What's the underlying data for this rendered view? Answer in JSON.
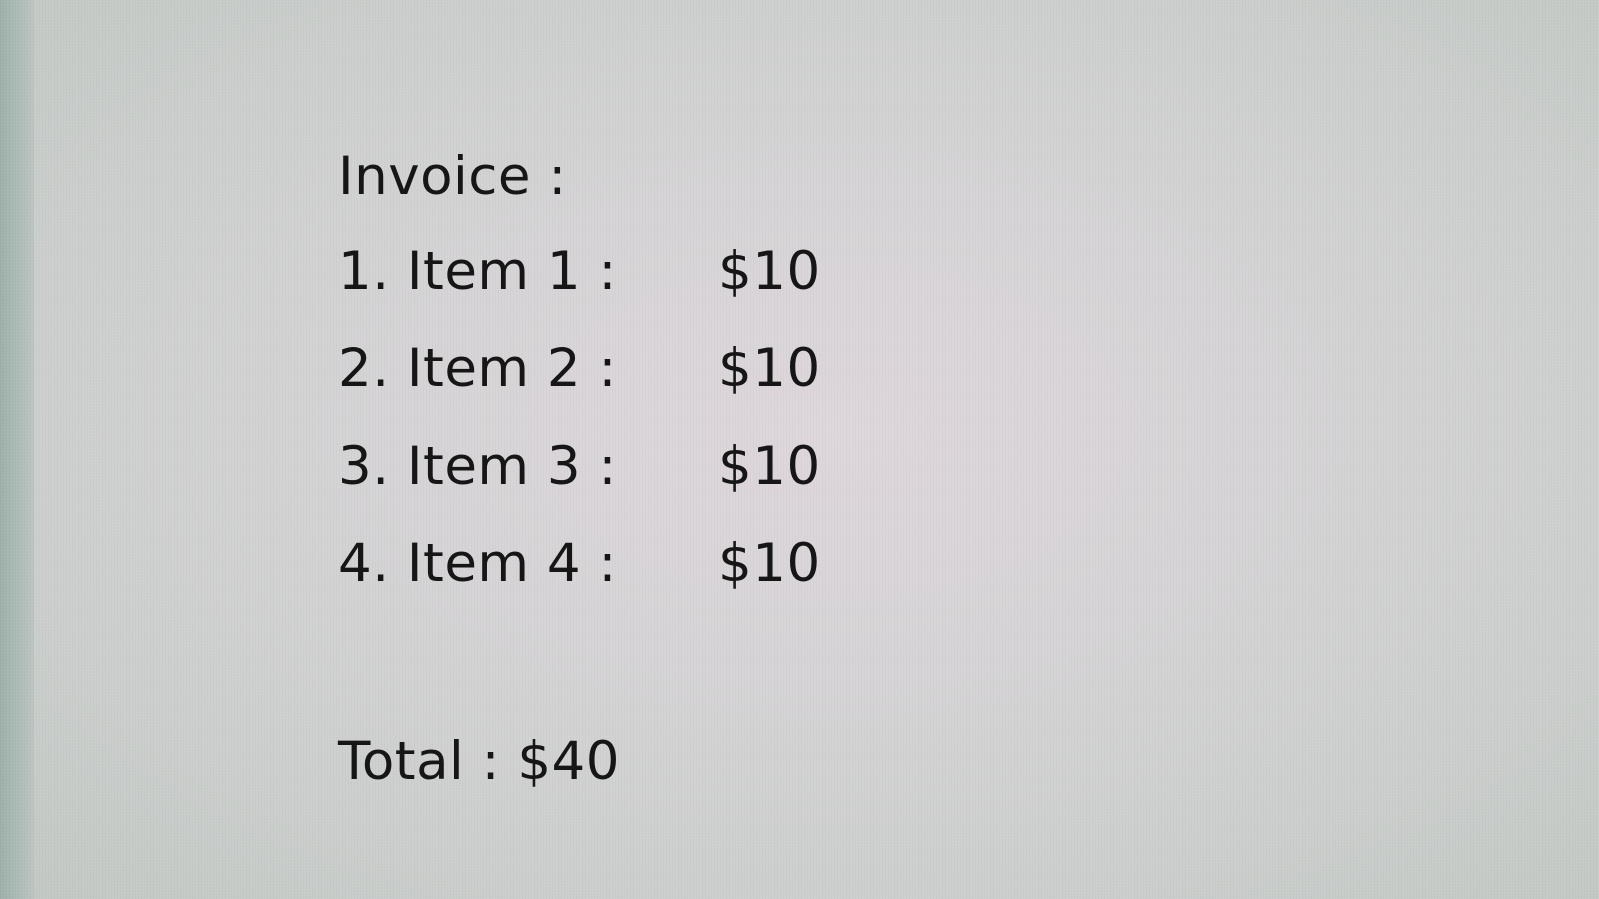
{
  "invoice": {
    "title": "Invoice :",
    "items": [
      {
        "label": "1. Item 1 :",
        "amount": "$10"
      },
      {
        "label": "2. Item 2 :",
        "amount": "$10"
      },
      {
        "label": "3. Item 3 :",
        "amount": "$10"
      },
      {
        "label": "4. Item 4 :",
        "amount": "$10"
      }
    ],
    "total": "Total : $40"
  }
}
